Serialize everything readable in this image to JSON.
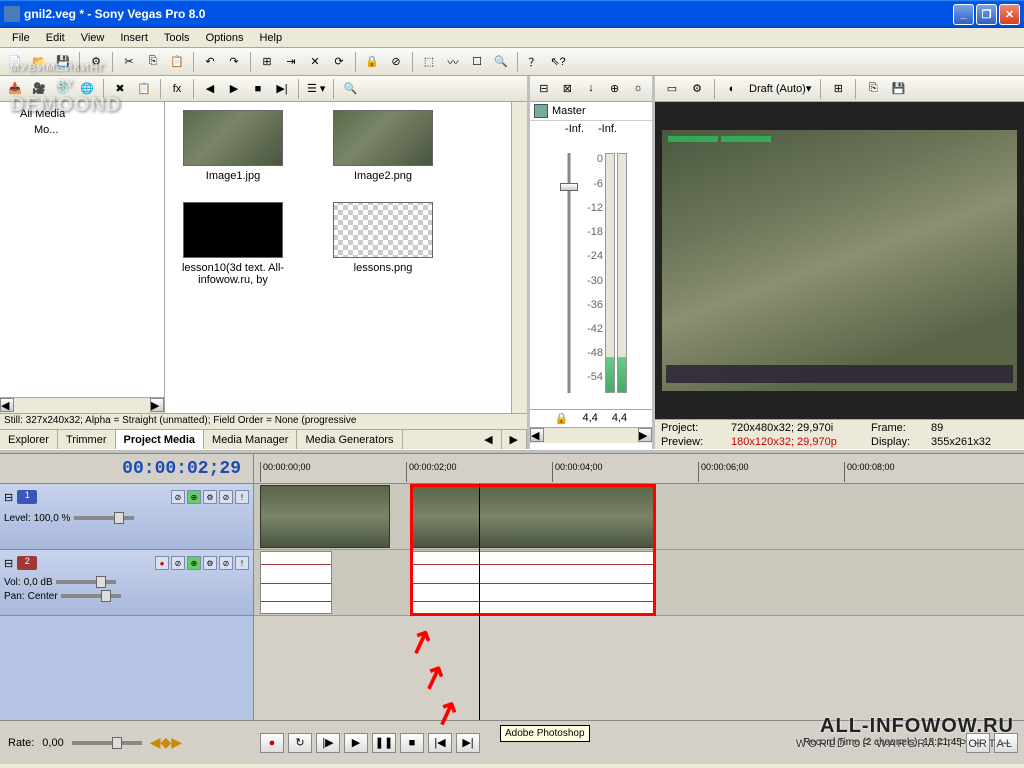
{
  "window": {
    "title": "gnil2.veg * - Sony Vegas Pro 8.0"
  },
  "menu": [
    "File",
    "Edit",
    "View",
    "Insert",
    "Tools",
    "Options",
    "Help"
  ],
  "media": {
    "tree_root": "All Media",
    "tree_child": "Mo...",
    "items": [
      {
        "name": "Image1.jpg",
        "kind": "game"
      },
      {
        "name": "Image2.png",
        "kind": "game"
      },
      {
        "name": "lesson10(3d text. All-infowow.ru, by",
        "kind": "black"
      },
      {
        "name": "lessons.png",
        "kind": "checker"
      }
    ],
    "status": "Still: 327x240x32; Alpha = Straight (unmatted); Field Order = None (progressive"
  },
  "tabs": [
    "Explorer",
    "Trimmer",
    "Project Media",
    "Media Manager",
    "Media Generators"
  ],
  "mixer": {
    "title": "Master",
    "peak_l": "-Inf.",
    "peak_r": "-Inf.",
    "val_l": "4,4",
    "val_r": "4,4",
    "scale": [
      "0",
      "-6",
      "-12",
      "-18",
      "-24",
      "-30",
      "-36",
      "-42",
      "-48",
      "-54"
    ]
  },
  "preview": {
    "quality": "Draft (Auto)",
    "info": {
      "project_label": "Project:",
      "project_value": "720x480x32; 29,970i",
      "preview_label": "Preview:",
      "preview_value": "180x120x32; 29,970p",
      "frame_label": "Frame:",
      "frame_value": "89",
      "display_label": "Display:",
      "display_value": "355x261x32"
    }
  },
  "timeline": {
    "timecode": "00:00:02;29",
    "ruler": [
      "00:00:00;00",
      "00:00:02;00",
      "00:00:04;00",
      "00:00:06;00",
      "00:00:08;00"
    ],
    "track1": {
      "num": "1",
      "level_label": "Level:",
      "level_value": "100,0 %"
    },
    "track2": {
      "num": "2",
      "vol_label": "Vol:",
      "vol_value": "0,0 dB",
      "pan_label": "Pan:",
      "pan_value": "Center"
    },
    "rate_label": "Rate:",
    "rate_value": "0,00",
    "record_time": "Record Time (2 channels): 18:21:45"
  },
  "tooltip": "Adobe Photoshop",
  "watermark": {
    "top_line1": "МУВИМЕЙКИНГ",
    "top_by": "BY",
    "top_author": "DEMOOND",
    "br_line1": "ALL-INFOWOW.RU",
    "br_line2": "WORLD OF WARCRAFT PORTAL"
  }
}
